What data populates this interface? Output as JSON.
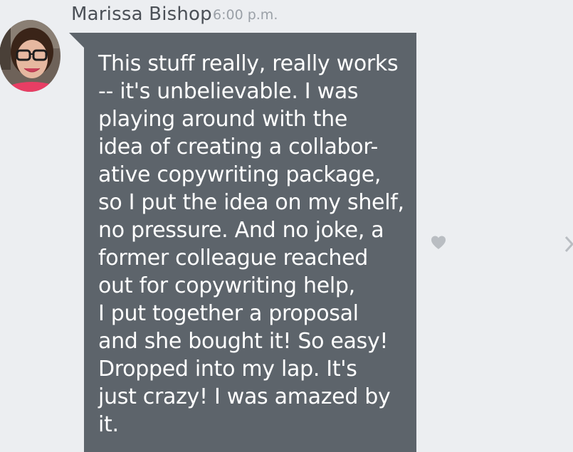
{
  "message": {
    "sender_name": "Marissa Bishop",
    "timestamp": "6:00 p.m.",
    "text": "This stuff really, really works\n-- it's unbelievable. I was\nplaying around with the\nidea of creating a collabor-\native copywriting package,\nso I put the idea on my shelf,\nno pressure. And no joke, a\nformer colleague reached\nout for copywriting help,\nI put together a proposal\nand she bought it! So easy!\nDropped into my lap. It's\njust crazy! I was amazed by\nit."
  },
  "icons": {
    "like": "heart-icon",
    "next": "chevron-right-icon",
    "avatar": "avatar"
  },
  "colors": {
    "background": "#eceef1",
    "bubble": "#5d646b",
    "bubble_text": "#ffffff",
    "sender_name": "#4b5057",
    "timestamp": "#9aa0a7",
    "icon": "#b9bdc2"
  }
}
